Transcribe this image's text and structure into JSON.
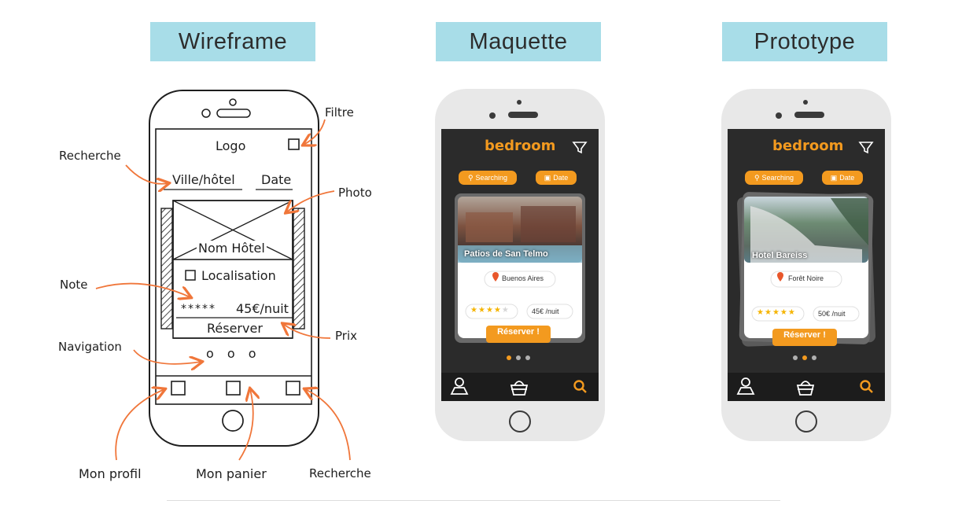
{
  "headers": {
    "wireframe": "Wireframe",
    "maquette": "Maquette",
    "prototype": "Prototype"
  },
  "wireframe": {
    "logo": "Logo",
    "search_city": "Ville/hôtel",
    "search_date": "Date",
    "hotel_name": "Nom Hôtel",
    "location": "Localisation",
    "rating_stars": "*****",
    "price": "45€/nuit",
    "book": "Réserver",
    "dots": "o o o",
    "annotations": {
      "filtre": "Filtre",
      "recherche_top": "Recherche",
      "photo": "Photo",
      "note": "Note",
      "prix": "Prix",
      "navigation": "Navigation",
      "mon_profil": "Mon profil",
      "mon_panier": "Mon panier",
      "recherche_bottom": "Recherche"
    }
  },
  "maquette": {
    "brand": "bedroom",
    "search_chip": "Searching",
    "date_chip": "Date",
    "hotel_name": "Patios de San Telmo",
    "location": "Buenos Aires",
    "rating_value": 4,
    "price": "45€ /nuit",
    "book": "Réserver !",
    "active_dot": 0
  },
  "prototype": {
    "brand": "bedroom",
    "search_chip": "Searching",
    "date_chip": "Date",
    "hotel_name": "Hotel Bareiss",
    "location": "Forêt Noire",
    "rating_value": 4.5,
    "price": "50€ /nuit",
    "book": "Réserver !",
    "active_dot": 1
  },
  "colors": {
    "title_bg": "#a8dde8",
    "accent": "#f39a1f",
    "phone_screen": "#2b2b2b",
    "phone_body": "#e8e8e8",
    "arrow": "#f0763a"
  }
}
